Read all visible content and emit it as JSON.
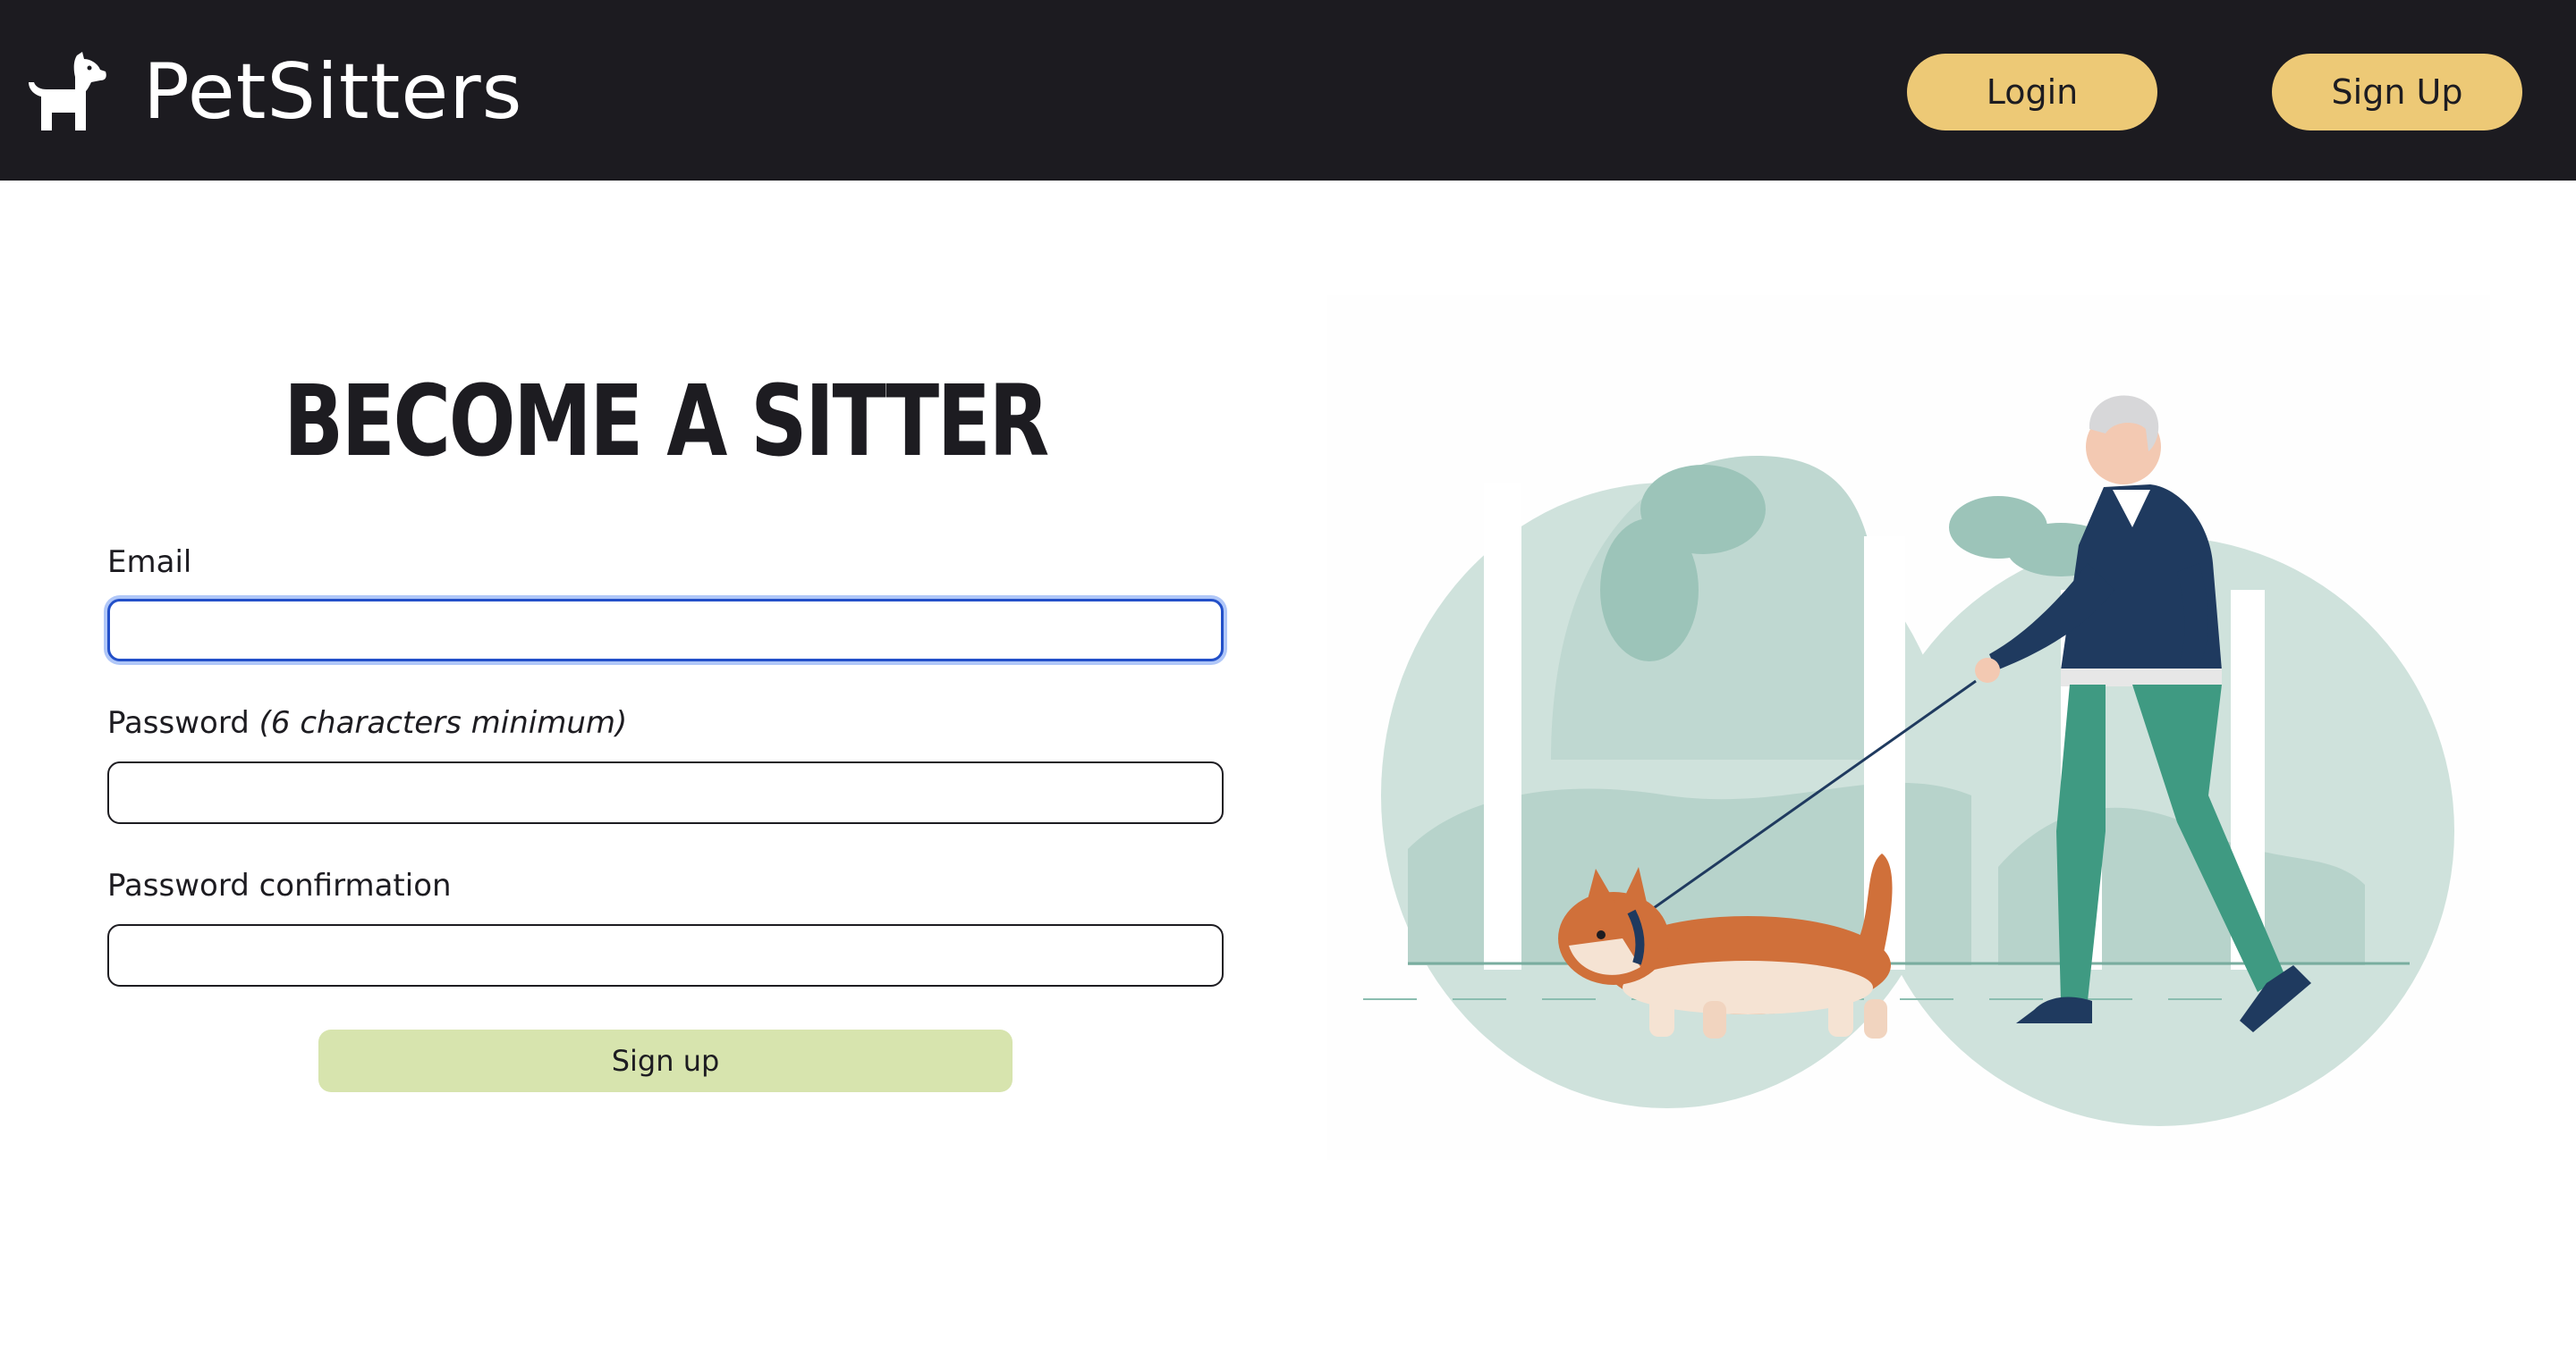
{
  "header": {
    "brand_name": "PetSitters",
    "brand_icon": "dog-icon",
    "login_label": "Login",
    "signup_label": "Sign Up"
  },
  "form": {
    "title": "BECOME A SITTER",
    "email_label": "Email",
    "email_value": "",
    "password_label": "Password",
    "password_hint": "(6 characters minimum)",
    "password_value": "",
    "confirm_label": "Password confirmation",
    "confirm_value": "",
    "submit_label": "Sign up"
  },
  "colors": {
    "navbar_bg": "#1c1b20",
    "nav_button": "#edc976",
    "submit_button": "#d7e4ae",
    "focus_border": "#2350c9"
  },
  "illustration": {
    "subject": "man-walking-corgi-illustration"
  }
}
